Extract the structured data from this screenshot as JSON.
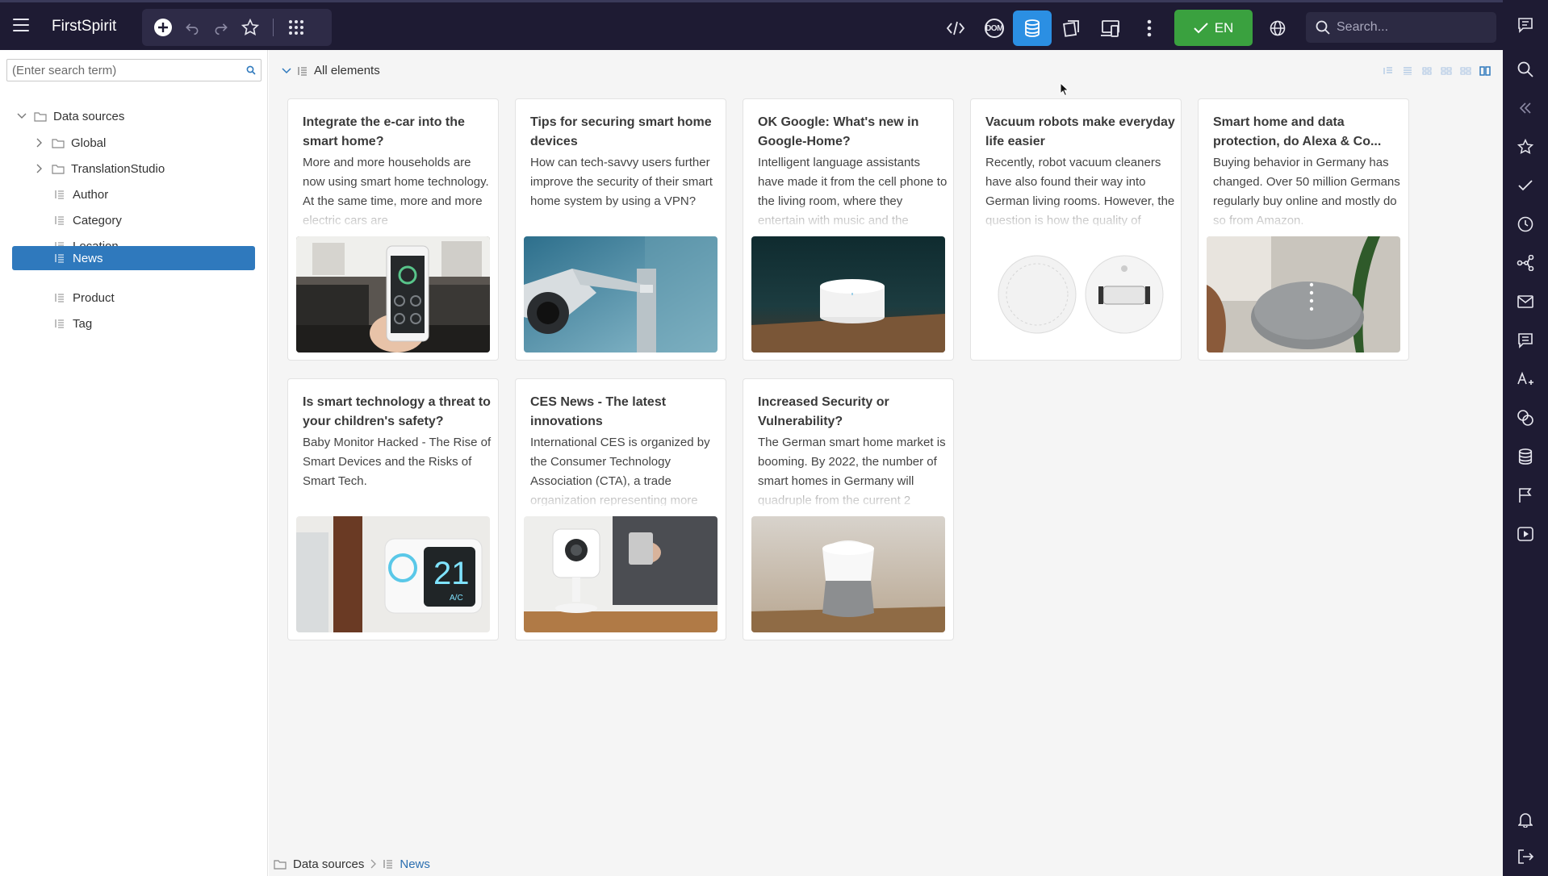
{
  "app": {
    "title": "FirstSpirit"
  },
  "topbar": {
    "language_label": "EN",
    "search_placeholder": "Search...",
    "colors": {
      "bar": "#1e1b33",
      "active": "#2b8fe3",
      "language": "#3aa13f"
    }
  },
  "left": {
    "search_placeholder": "(Enter search term)",
    "tree": {
      "root": "Data sources",
      "folders": [
        "Global",
        "TranslationStudio"
      ],
      "tables": [
        "Author",
        "Category",
        "Location",
        "News",
        "Product",
        "Tag"
      ],
      "selected": "News"
    }
  },
  "main": {
    "header_label": "All elements",
    "cards": [
      {
        "title": "Integrate the e-car into the smart home?",
        "text": "More and more households are now using smart home technology. At the same time, more and more electric cars are",
        "image": "smartphone-kitchen"
      },
      {
        "title": "Tips for securing smart home devices",
        "text": "How can tech-savvy users further improve the security of their smart home system by using a VPN?",
        "image": "security-camera"
      },
      {
        "title": "OK Google: What's new in Google-Home?",
        "text": "Intelligent language assistants have made it from the cell phone to the living room, where they entertain with music and the",
        "image": "google-wifi"
      },
      {
        "title": "Vacuum robots make everyday life easier",
        "text": "Recently, robot vacuum cleaners have also found their way into German living rooms. However, the question is how the quality of",
        "image": "robot-vacuum"
      },
      {
        "title": "Smart home and data protection, do Alexa & Co...",
        "text": "Buying behavior in Germany has changed. Over 50 million Germans regularly buy online and mostly do so from Amazon.",
        "image": "google-home-mini"
      },
      {
        "title": "Is smart technology a threat to your children's safety?",
        "text": "Baby Monitor Hacked - The Rise of Smart Devices and the Risks of Smart Tech.",
        "image": "thermostat",
        "thermostat_value": "21"
      },
      {
        "title": "CES News - The latest innovations",
        "text": "International CES is organized by the Consumer Technology Association (CTA), a trade organization representing more",
        "image": "ip-camera"
      },
      {
        "title": "Increased Security or Vulnerability?",
        "text": "The German smart home market is booming. By 2022, the number of smart homes in Germany will quadruple from the current 2",
        "image": "google-home"
      }
    ]
  },
  "breadcrumb": {
    "root": "Data sources",
    "current": "News"
  }
}
